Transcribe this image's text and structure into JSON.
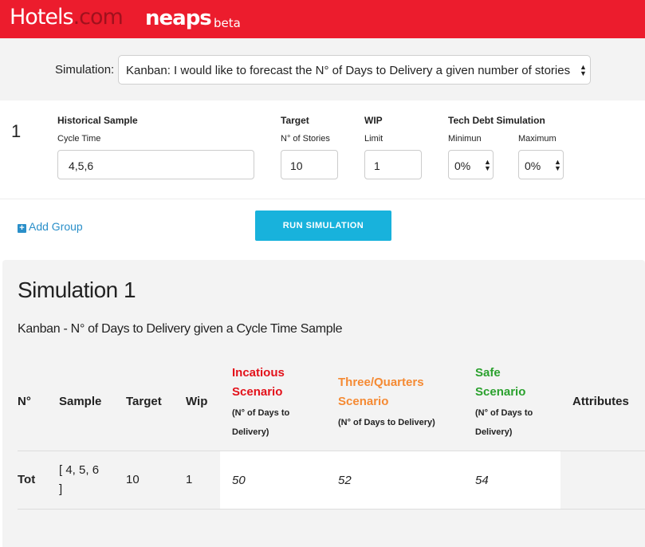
{
  "header": {
    "logo_main": "Hotels",
    "logo_dot": ".com",
    "app_name": "neaps",
    "app_tag": "beta"
  },
  "simulation_select": {
    "label": "Simulation:",
    "value": "Kanban: I would like to forecast the N° of Days to Delivery a given number of stories"
  },
  "group": {
    "number": "1",
    "historical_sample_label": "Historical Sample",
    "cycle_time_label": "Cycle Time",
    "cycle_time_value": "4,5,6",
    "target_label": "Target",
    "stories_label": "N° of Stories",
    "stories_value": "10",
    "wip_label": "WIP",
    "limit_label": "Limit",
    "limit_value": "1",
    "tech_debt_label": "Tech Debt Simulation",
    "minimum_label": "Minimun",
    "minimum_value": "0%",
    "maximum_label": "Maximum",
    "maximum_value": "0%"
  },
  "actions": {
    "add_group": "Add Group",
    "run_simulation": "RUN SIMULATION"
  },
  "results": {
    "title": "Simulation 1",
    "subtitle": "Kanban - N° of Days to Delivery given a Cycle Time Sample",
    "colors": {
      "incautious": "#e3121b",
      "three_quarters": "#f58a33",
      "safe": "#2ba12e"
    },
    "headers": {
      "n": "N°",
      "sample": "Sample",
      "target": "Target",
      "wip": "Wip",
      "incautious_1": "Incatious",
      "incautious_2": "Scenario",
      "incautious_note_1": "(N° of Days to",
      "incautious_note_2": "Delivery)",
      "three_quarters_1": "Three/Quarters",
      "three_quarters_2": "Scenario",
      "three_quarters_note": "(N° of Days to Delivery)",
      "safe_1": "Safe",
      "safe_2": "Scenario",
      "safe_note_1": "(N° of Days to",
      "safe_note_2": "Delivery)",
      "attributes": "Attributes"
    },
    "row": {
      "n": "Tot",
      "sample_1": "[ 4, 5, 6",
      "sample_2": "]",
      "target": "10",
      "wip": "1",
      "incautious": "50",
      "three_quarters": "52",
      "safe": "54"
    }
  }
}
